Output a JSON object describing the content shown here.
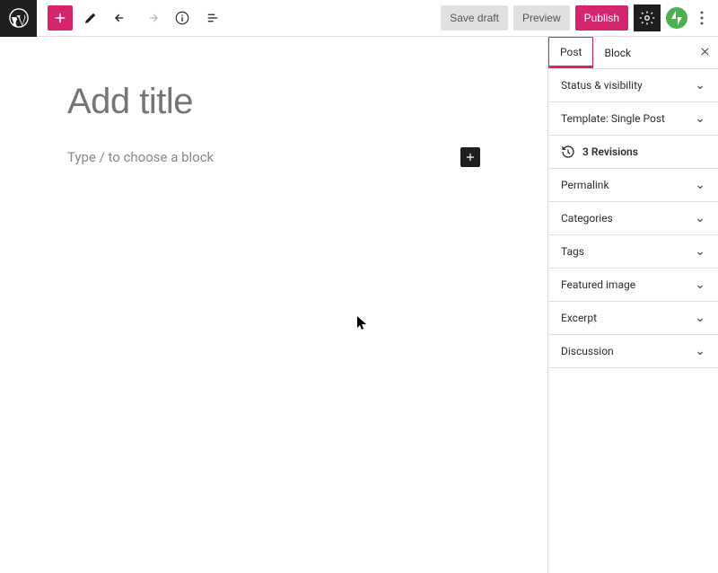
{
  "topbar": {
    "save_draft": "Save draft",
    "preview": "Preview",
    "publish": "Publish"
  },
  "editor": {
    "title_placeholder": "Add title",
    "block_placeholder": "Type / to choose a block"
  },
  "sidebar": {
    "tabs": [
      {
        "label": "Post"
      },
      {
        "label": "Block"
      }
    ],
    "panels": {
      "status": "Status & visibility",
      "template": "Template: Single Post",
      "revisions": "3 Revisions",
      "permalink": "Permalink",
      "categories": "Categories",
      "tags": "Tags",
      "featured_image": "Featured image",
      "excerpt": "Excerpt",
      "discussion": "Discussion"
    }
  }
}
